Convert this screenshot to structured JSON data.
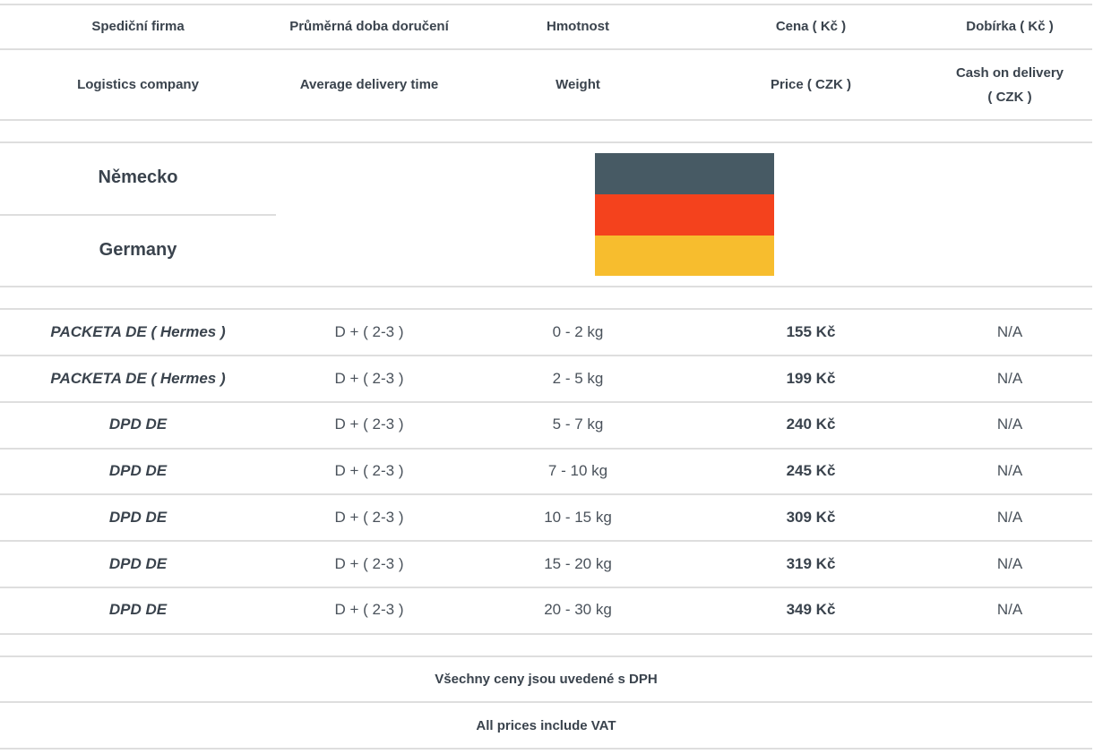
{
  "header_cz": {
    "company": "Spediční firma",
    "time": "Průměrná doba doručení",
    "weight": "Hmotnost",
    "price": "Cena ( Kč )",
    "cod": "Dobírka ( Kč )"
  },
  "header_en": {
    "company": "Logistics company",
    "time": "Average delivery time",
    "weight": "Weight",
    "price": "Price ( CZK )",
    "cod_line1": "Cash on delivery",
    "cod_line2": "( CZK )"
  },
  "country": {
    "name_cz": "Německo",
    "name_en": "Germany",
    "flag_colors": [
      "#475a64",
      "#f4421d",
      "#f7bd2e"
    ]
  },
  "rows": [
    {
      "carrier": "PACKETA DE ( Hermes )",
      "time": "D + ( 2-3 )",
      "weight": "0 - 2 kg",
      "price": "155 Kč",
      "cod": "N/A"
    },
    {
      "carrier": "PACKETA DE ( Hermes )",
      "time": "D + ( 2-3 )",
      "weight": "2 - 5 kg",
      "price": "199 Kč",
      "cod": "N/A"
    },
    {
      "carrier": "DPD DE",
      "time": "D + ( 2-3 )",
      "weight": "5 - 7 kg",
      "price": "240 Kč",
      "cod": "N/A"
    },
    {
      "carrier": "DPD DE",
      "time": "D + ( 2-3 )",
      "weight": "7 - 10 kg",
      "price": "245 Kč",
      "cod": "N/A"
    },
    {
      "carrier": "DPD DE",
      "time": "D + ( 2-3 )",
      "weight": "10 - 15 kg",
      "price": "309 Kč",
      "cod": "N/A"
    },
    {
      "carrier": "DPD DE",
      "time": "D + ( 2-3 )",
      "weight": "15 - 20 kg",
      "price": "319 Kč",
      "cod": "N/A"
    },
    {
      "carrier": "DPD DE",
      "time": "D + ( 2-3 )",
      "weight": "20 - 30 kg",
      "price": "349 Kč",
      "cod": "N/A"
    }
  ],
  "footer": {
    "vat_cz": "Všechny ceny jsou uvedené s DPH",
    "vat_en": "All prices include VAT"
  }
}
